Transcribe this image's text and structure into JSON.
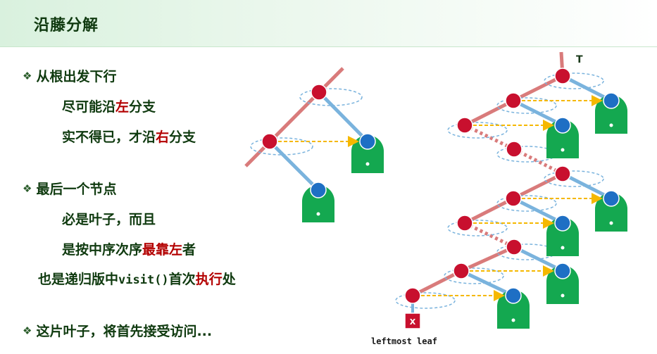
{
  "title": "沿藤分解",
  "bullets": [
    {
      "prefix": "❖",
      "text": "从根出发下行"
    },
    {
      "prefix": "❖",
      "text": "最后一个节点"
    },
    {
      "prefix": "❖",
      "text": "这片叶子，将首先接受访问..."
    }
  ],
  "sub1": {
    "a": "尽可能沿",
    "b": "左",
    "c": "分支"
  },
  "sub2": {
    "a": "实不得已，才沿",
    "b": "右",
    "c": "分支"
  },
  "sub3": {
    "a": "必是叶子，而且"
  },
  "sub4": {
    "a": "是按中序次序",
    "b": "最靠左",
    "c": "者"
  },
  "sub5": {
    "a": "也是递归版中",
    "code": "visit()",
    "b": "首次",
    "c": "执行",
    "d": "处"
  },
  "diagram": {
    "root_label": "T",
    "x_label": "X",
    "caption": "leftmost leaf"
  },
  "colors": {
    "red_node": "#c8102e",
    "blue_node": "#1e6fc4",
    "subtree": "#14a850",
    "left_branch": "#d97b7b",
    "right_branch": "#7ab3dd",
    "dashed_arrow": "#f5b800",
    "loop": "#7ab3dd"
  }
}
